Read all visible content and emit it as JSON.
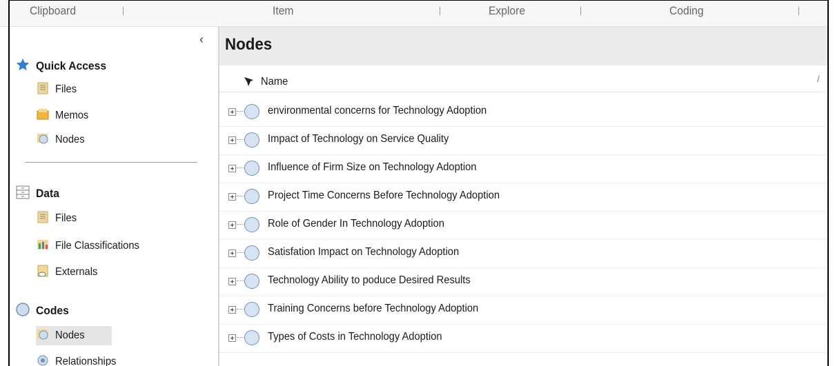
{
  "ribbon": {
    "groups": [
      "Clipboard",
      "Item",
      "Explore",
      "Coding"
    ]
  },
  "navigation": {
    "collapse_glyph": "‹",
    "quick_access": {
      "label": "Quick Access",
      "items": [
        {
          "label": "Files",
          "icon": "files-icon"
        },
        {
          "label": "Memos",
          "icon": "memos-icon"
        },
        {
          "label": "Nodes",
          "icon": "nodes-icon"
        }
      ]
    },
    "data": {
      "label": "Data",
      "items": [
        {
          "label": "Files",
          "icon": "files-icon"
        },
        {
          "label": "File Classifications",
          "icon": "file-classifications-icon"
        },
        {
          "label": "Externals",
          "icon": "externals-icon"
        }
      ]
    },
    "codes": {
      "label": "Codes",
      "items": [
        {
          "label": "Nodes",
          "icon": "nodes-icon",
          "selected": true
        },
        {
          "label": "Relationships",
          "icon": "relationships-icon"
        }
      ]
    }
  },
  "main": {
    "title": "Nodes",
    "columns": {
      "name": "Name",
      "sort_mark": "/"
    },
    "rows": [
      "environmental concerns for Technology Adoption",
      "Impact of Technology on Service  Quality",
      "Influence  of Firm Size on Technology Adoption",
      "Project Time Concerns Before Technology Adoption",
      "Role of Gender In Technology Adoption",
      "Satisfation Impact on Technology Adoption",
      "Technology Ability to poduce Desired Results",
      "Training Concerns before Technology Adoption",
      "Types of Costs in Technology Adoption"
    ]
  },
  "colors": {
    "accent_star": "#2f7fd6",
    "node_fill": "#d7e3f3",
    "node_border": "#6f8fb9",
    "title_bar": "#ececec",
    "selected": "#e5e5e5"
  }
}
